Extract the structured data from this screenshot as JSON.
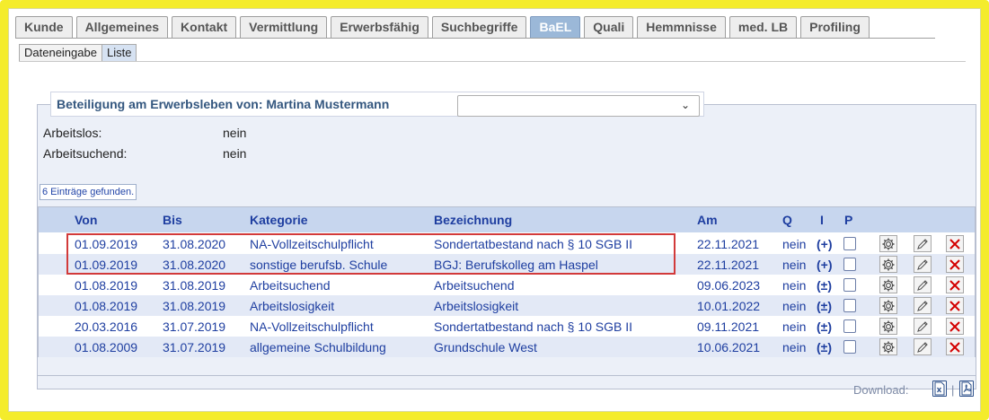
{
  "tabs": [
    {
      "label": "Kunde"
    },
    {
      "label": "Allgemeines"
    },
    {
      "label": "Kontakt"
    },
    {
      "label": "Vermittlung"
    },
    {
      "label": "Erwerbsfähig"
    },
    {
      "label": "Suchbegriffe"
    },
    {
      "label": "BaEL",
      "active": true
    },
    {
      "label": "Quali"
    },
    {
      "label": "Hemmnisse"
    },
    {
      "label": "med. LB"
    },
    {
      "label": "Profiling"
    }
  ],
  "subtabs": [
    {
      "label": "Dateneingabe"
    },
    {
      "label": "Liste",
      "active": true
    }
  ],
  "panel": {
    "title": "Beteiligung am Erwerbsleben von: Martina Mustermann",
    "select_value": ""
  },
  "status": {
    "arbeitslos_label": "Arbeitslos:",
    "arbeitslos_value": "nein",
    "arbeitsuchend_label": "Arbeitsuchend:",
    "arbeitsuchend_value": "nein"
  },
  "found_text": "6 Einträge gefunden.",
  "table": {
    "headers": {
      "von": "Von",
      "bis": "Bis",
      "kategorie": "Kategorie",
      "bezeichnung": "Bezeichnung",
      "am": "Am",
      "q": "Q",
      "i": "I",
      "p": "P"
    },
    "rows": [
      {
        "von": "01.09.2019",
        "bis": "31.08.2020",
        "kategorie": "NA-Vollzeitschulpflicht",
        "bezeichnung": "Sondertatbestand nach § 10 SGB II",
        "am": "22.11.2021",
        "q": "nein",
        "i": "(+)"
      },
      {
        "von": "01.09.2019",
        "bis": "31.08.2020",
        "kategorie": "sonstige berufsb. Schule",
        "bezeichnung": "BGJ: Berufskolleg am Haspel",
        "am": "22.11.2021",
        "q": "nein",
        "i": "(+)"
      },
      {
        "von": "01.08.2019",
        "bis": "31.08.2019",
        "kategorie": "Arbeitsuchend",
        "bezeichnung": "Arbeitsuchend",
        "am": "09.06.2023",
        "q": "nein",
        "i": "(±)"
      },
      {
        "von": "01.08.2019",
        "bis": "31.08.2019",
        "kategorie": "Arbeitslosigkeit",
        "bezeichnung": "Arbeitslosigkeit",
        "am": "10.01.2022",
        "q": "nein",
        "i": "(±)"
      },
      {
        "von": "20.03.2016",
        "bis": "31.07.2019",
        "kategorie": "NA-Vollzeitschulpflicht",
        "bezeichnung": "Sondertatbestand nach § 10 SGB II",
        "am": "09.11.2021",
        "q": "nein",
        "i": "(±)"
      },
      {
        "von": "01.08.2009",
        "bis": "31.07.2019",
        "kategorie": "allgemeine Schulbildung",
        "bezeichnung": "Grundschule West",
        "am": "10.06.2021",
        "q": "nein",
        "i": "(±)"
      }
    ]
  },
  "footer": {
    "download_label": "Download:",
    "separator": "|",
    "excel_icon": "excel-icon",
    "pdf_icon": "pdf-icon"
  },
  "colors": {
    "frame": "#f4ec2c",
    "active_tab": "#9bb8d8",
    "header_bg": "#c7d6ee",
    "link_text": "#1e3ea0",
    "highlight": "#d23a3a",
    "delete": "#d40000"
  }
}
